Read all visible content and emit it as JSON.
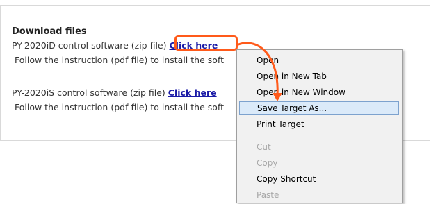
{
  "section": {
    "heading": "Download files",
    "item1": {
      "text": "PY-2020iD control software (zip file) ",
      "link": "Click here",
      "instruction": "Follow the instruction (pdf file) to install the soft"
    },
    "item2": {
      "text": "PY-2020iS control software (zip file) ",
      "link": "Click here",
      "instruction": "Follow the instruction (pdf file) to install the soft"
    }
  },
  "context_menu": {
    "items": [
      {
        "label": "Open",
        "enabled": true
      },
      {
        "label": "Open in New Tab",
        "enabled": true
      },
      {
        "label": "Open in New Window",
        "enabled": true
      },
      {
        "label": "Save Target As...",
        "enabled": true,
        "selected": true
      },
      {
        "label": "Print Target",
        "enabled": true
      },
      {
        "label": "Cut",
        "enabled": false
      },
      {
        "label": "Copy",
        "enabled": false
      },
      {
        "label": "Copy Shortcut",
        "enabled": true
      },
      {
        "label": "Paste",
        "enabled": false
      }
    ]
  },
  "colors": {
    "link": "#1a1aa6",
    "annotation": "#ff5a1a",
    "selection_bg": "#dbeaf9",
    "selection_border": "#7da2ce"
  },
  "icons": {
    "annotation_arrow": "curved-arrow-icon"
  }
}
